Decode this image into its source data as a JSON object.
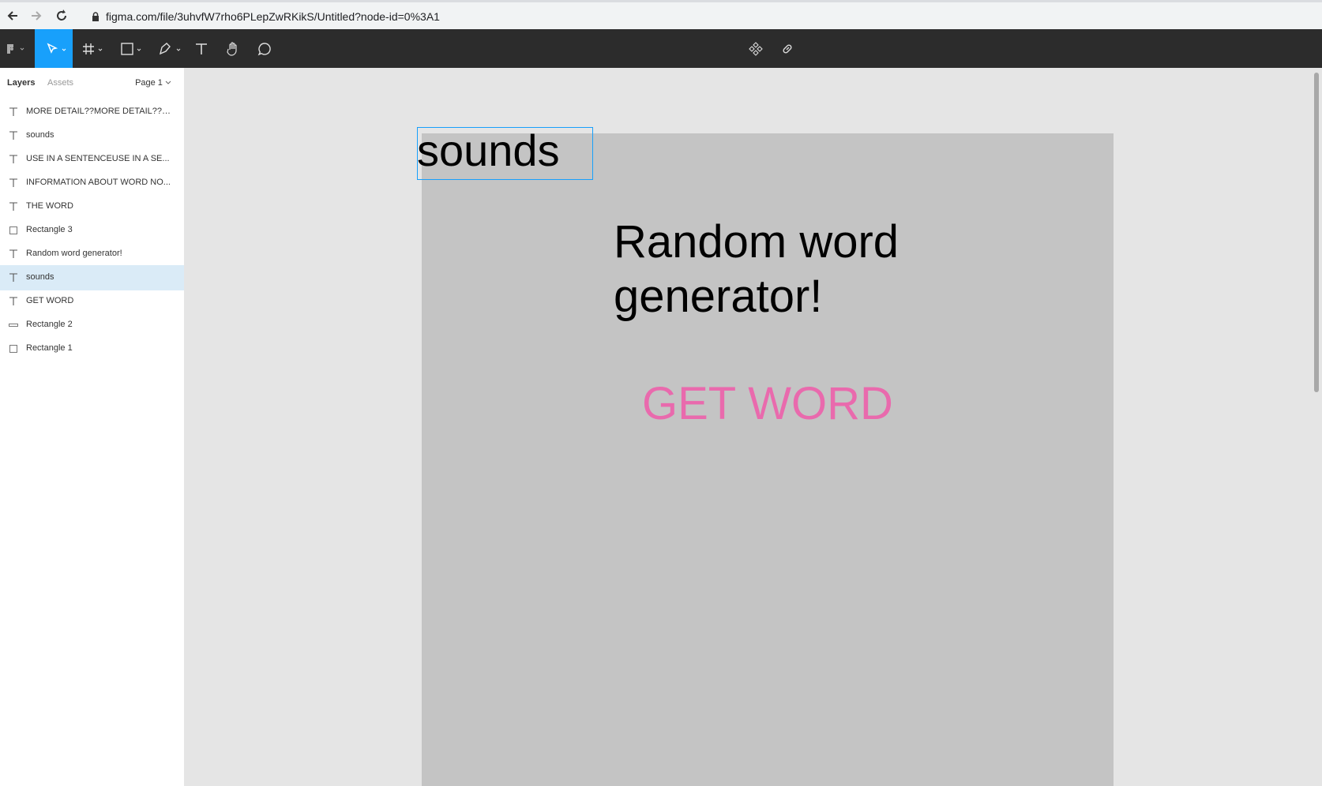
{
  "browser": {
    "url": "figma.com/file/3uhvfW7rho6PLepZwRKikS/Untitled?node-id=0%3A1"
  },
  "toolbar": {
    "tools": [
      "figma-menu",
      "move",
      "frame",
      "shape",
      "pen",
      "text",
      "hand",
      "comment"
    ],
    "active_tool": "move",
    "center_tools": [
      "components",
      "link"
    ],
    "accent": "#18a0fb"
  },
  "left_panel": {
    "tabs": [
      "Layers",
      "Assets"
    ],
    "page": "Page 1",
    "layers": [
      {
        "type": "text",
        "name": "MORE DETAIL??MORE DETAIL??M..."
      },
      {
        "type": "text",
        "name": "sounds"
      },
      {
        "type": "text",
        "name": "USE IN A SENTENCEUSE IN A SE..."
      },
      {
        "type": "text",
        "name": "INFORMATION ABOUT WORD NO..."
      },
      {
        "type": "text",
        "name": "THE WORD"
      },
      {
        "type": "rect",
        "name": "Rectangle 3"
      },
      {
        "type": "text",
        "name": "Random word generator!"
      },
      {
        "type": "text",
        "name": "sounds",
        "selected": true
      },
      {
        "type": "text",
        "name": "GET WORD"
      },
      {
        "type": "line",
        "name": "Rectangle 2"
      },
      {
        "type": "rect",
        "name": "Rectangle 1"
      }
    ]
  },
  "canvas": {
    "selected_text": "sounds",
    "title": "Random word generator!",
    "button_text": "GET WORD",
    "button_color": "#e96aad",
    "frame_color": "#c4c4c4"
  }
}
